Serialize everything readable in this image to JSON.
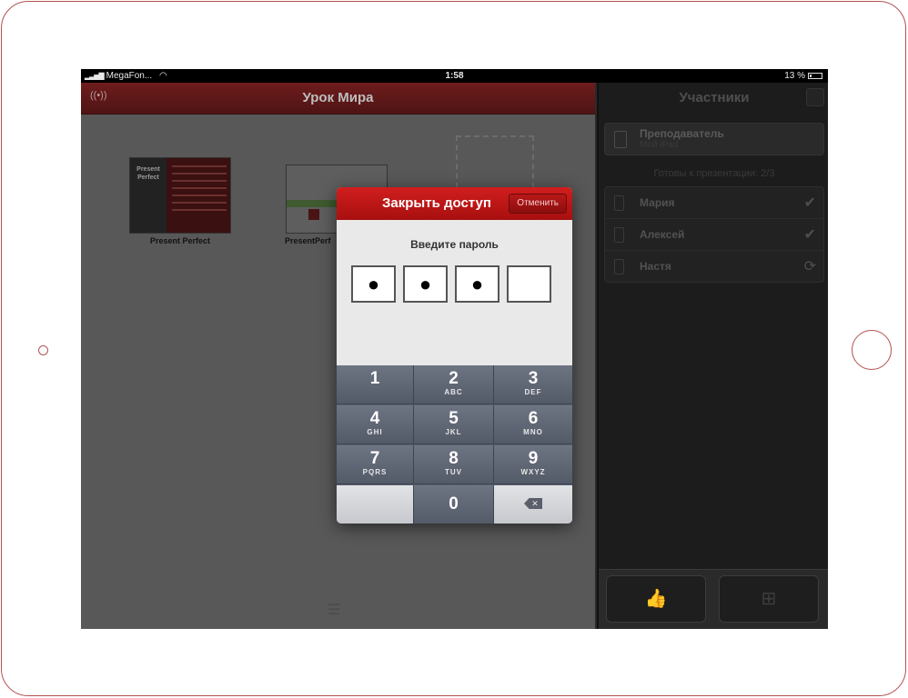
{
  "status_bar": {
    "carrier": "MegaFon...",
    "time": "1:58",
    "battery": "13 %"
  },
  "left": {
    "title": "Урок Мира",
    "documents": [
      {
        "name": "Present Perfect",
        "thumb_title": "Present Perfect"
      },
      {
        "name": "PresentPerf"
      }
    ]
  },
  "right": {
    "title": "Участники",
    "teacher": {
      "name": "Преподаватель",
      "device": "Мой iPad"
    },
    "ready_text": "Готовы к презентации: 2/3",
    "students": [
      {
        "name": "Мария",
        "status_icon": "checkmark-icon"
      },
      {
        "name": "Алексей",
        "status_icon": "checkmark-icon"
      },
      {
        "name": "Настя",
        "status_icon": "sync-icon"
      }
    ]
  },
  "dialog": {
    "title": "Закрыть доступ",
    "cancel_label": "Отменить",
    "prompt": "Введите пароль",
    "pin": [
      "●",
      "●",
      "●",
      ""
    ],
    "keys": [
      {
        "num": "1",
        "letters": ""
      },
      {
        "num": "2",
        "letters": "ABC"
      },
      {
        "num": "3",
        "letters": "DEF"
      },
      {
        "num": "4",
        "letters": "GHI"
      },
      {
        "num": "5",
        "letters": "JKL"
      },
      {
        "num": "6",
        "letters": "MNO"
      },
      {
        "num": "7",
        "letters": "PQRS"
      },
      {
        "num": "8",
        "letters": "TUV"
      },
      {
        "num": "9",
        "letters": "WXYZ"
      },
      {
        "num": "0",
        "letters": ""
      }
    ]
  },
  "colors": {
    "accent_red": "#c01515",
    "header_dark_red": "#5e1818",
    "keypad": "#5a6170"
  }
}
